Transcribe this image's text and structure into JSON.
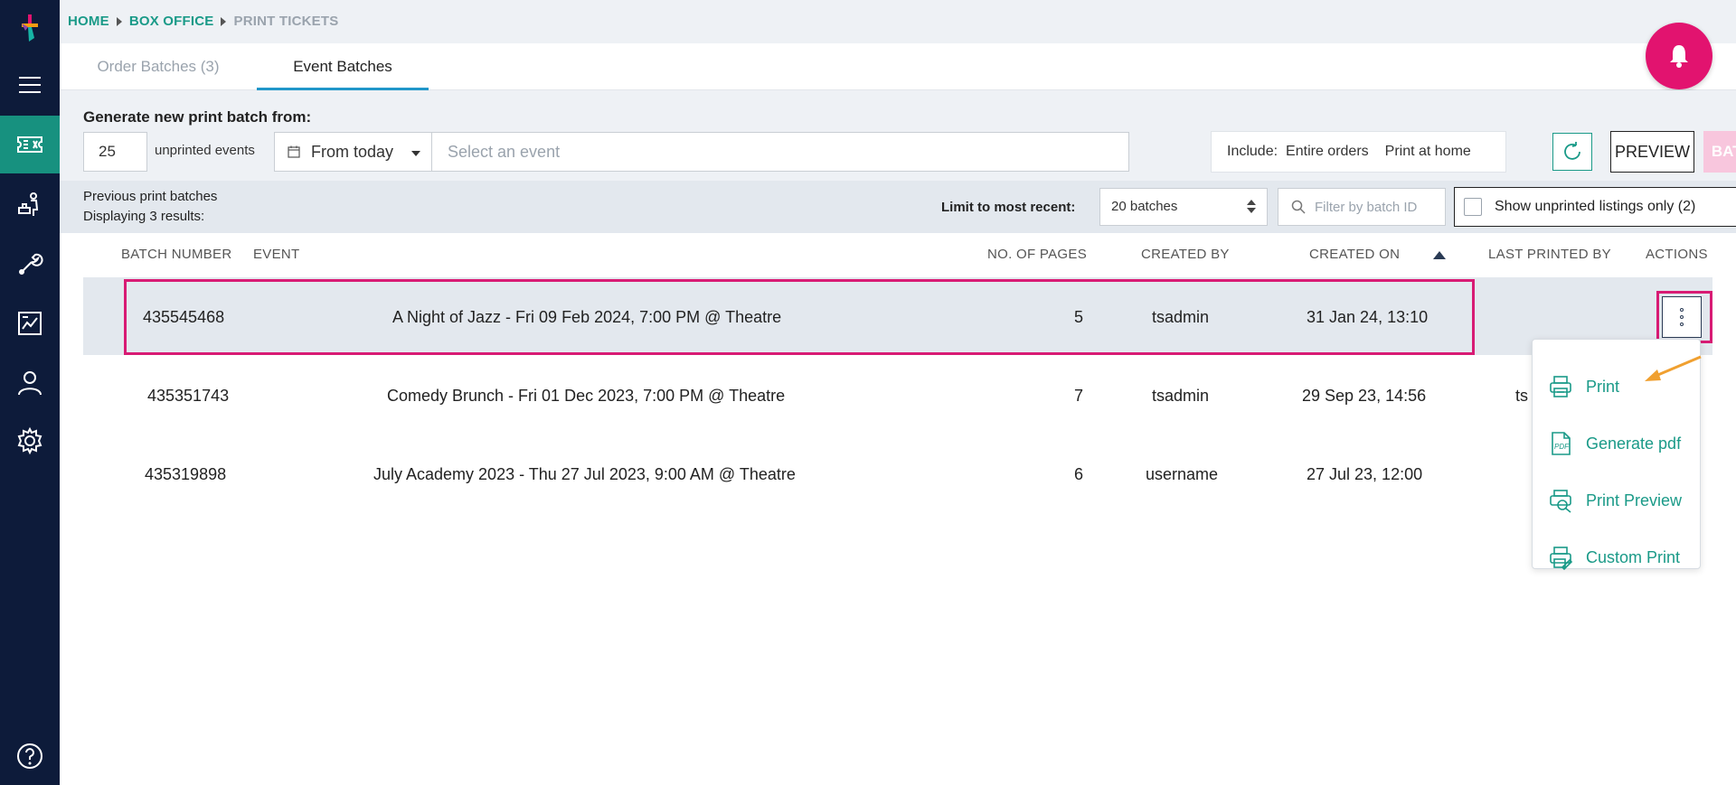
{
  "breadcrumb": {
    "home": "HOME",
    "box_office": "BOX OFFICE",
    "current": "PRINT TICKETS"
  },
  "tabs": [
    {
      "label": "Order Batches (3)"
    },
    {
      "label": "Event Batches"
    }
  ],
  "generate": {
    "title": "Generate new print batch from:",
    "count": "25",
    "count_label": "unprinted events",
    "date_filter": "From today",
    "event_placeholder": "Select an event",
    "include_label": "Include:",
    "include_opt1": "Entire orders",
    "include_opt2": "Print at home",
    "preview_label": "PREVIEW",
    "batch_label": "BATCH"
  },
  "previous": {
    "title": "Previous print batches",
    "count_text": "Displaying 3 results:",
    "limit_label": "Limit to most recent:",
    "limit_value": "20 batches",
    "filter_placeholder": "Filter by batch ID",
    "unprinted_toggle": "Show unprinted listings only (2)"
  },
  "table": {
    "headers": {
      "batch_number": "BATCH NUMBER",
      "event": "EVENT",
      "pages": "NO. OF PAGES",
      "created_by": "CREATED BY",
      "created_on": "CREATED ON",
      "last_printed_by": "LAST PRINTED BY",
      "actions": "ACTIONS"
    },
    "rows": [
      {
        "batch": "435545468",
        "event": "A Night of Jazz - Fri 09 Feb 2024, 7:00 PM @ Theatre",
        "pages": "5",
        "created_by": "tsadmin",
        "created_on": "31 Jan 24, 13:10",
        "last_printed_by": ""
      },
      {
        "batch": "435351743",
        "event": "Comedy Brunch - Fri 01 Dec 2023, 7:00 PM @ Theatre",
        "pages": "7",
        "created_by": "tsadmin",
        "created_on": "29 Sep 23, 14:56",
        "last_printed_by": "ts"
      },
      {
        "batch": "435319898",
        "event": "July Academy 2023 - Thu 27 Jul 2023, 9:00 AM @ Theatre",
        "pages": "6",
        "created_by": "username",
        "created_on": "27 Jul 23, 12:00",
        "last_printed_by": ""
      }
    ]
  },
  "actions_menu": [
    {
      "label": "Print",
      "icon": "printer-icon"
    },
    {
      "label": "Generate pdf",
      "icon": "pdf-icon"
    },
    {
      "label": "Print Preview",
      "icon": "print-preview-icon"
    },
    {
      "label": "Custom Print",
      "icon": "custom-print-icon"
    }
  ],
  "colors": {
    "sidebar": "#0d1b3a",
    "accent": "#1a9a88",
    "highlight": "#d81b74",
    "bell": "#e2136f"
  }
}
